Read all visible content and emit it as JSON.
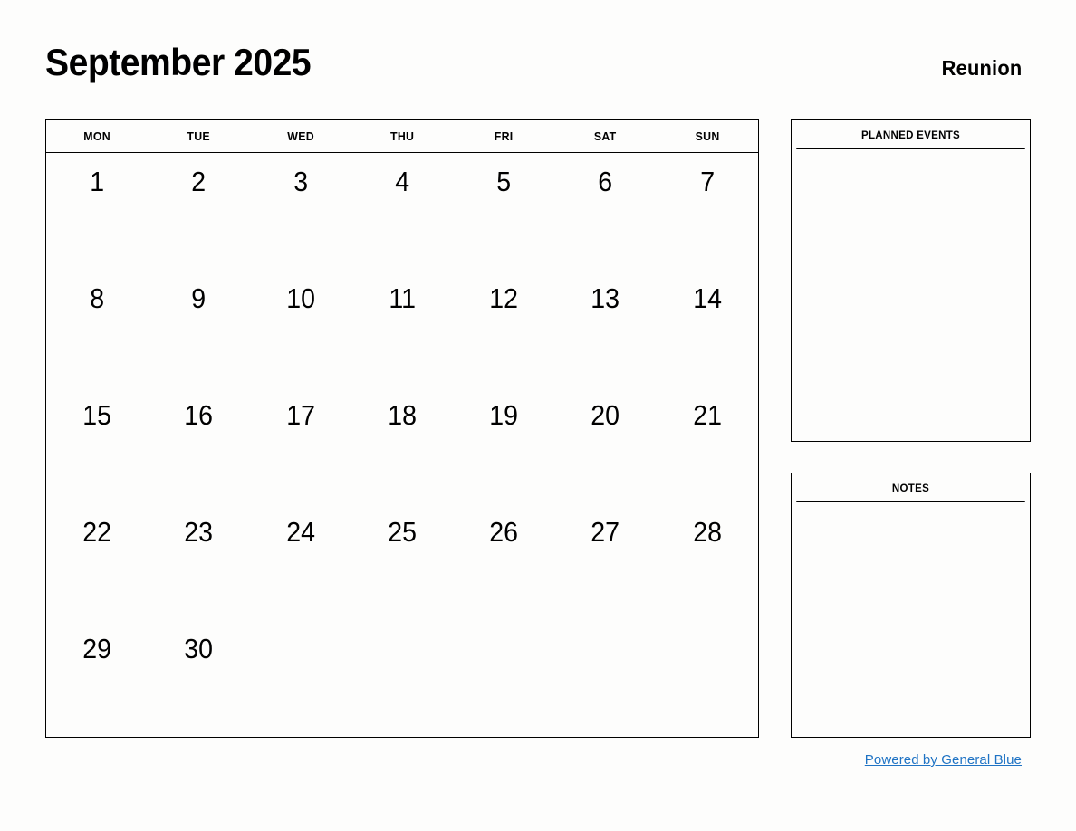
{
  "header": {
    "month_title": "September 2025",
    "location": "Reunion"
  },
  "calendar": {
    "weekdays": [
      "MON",
      "TUE",
      "WED",
      "THU",
      "FRI",
      "SAT",
      "SUN"
    ],
    "weeks": [
      [
        "1",
        "2",
        "3",
        "4",
        "5",
        "6",
        "7"
      ],
      [
        "8",
        "9",
        "10",
        "11",
        "12",
        "13",
        "14"
      ],
      [
        "15",
        "16",
        "17",
        "18",
        "19",
        "20",
        "21"
      ],
      [
        "22",
        "23",
        "24",
        "25",
        "26",
        "27",
        "28"
      ],
      [
        "29",
        "30",
        "",
        "",
        "",
        "",
        ""
      ]
    ]
  },
  "panels": {
    "planned_events": {
      "title": "PLANNED EVENTS",
      "content": ""
    },
    "notes": {
      "title": "NOTES",
      "content": ""
    }
  },
  "footer": {
    "link_text": "Powered by General Blue"
  },
  "colors": {
    "link": "#1f73c4",
    "border": "#000000",
    "background": "#fdfdfc",
    "text": "#000000"
  }
}
